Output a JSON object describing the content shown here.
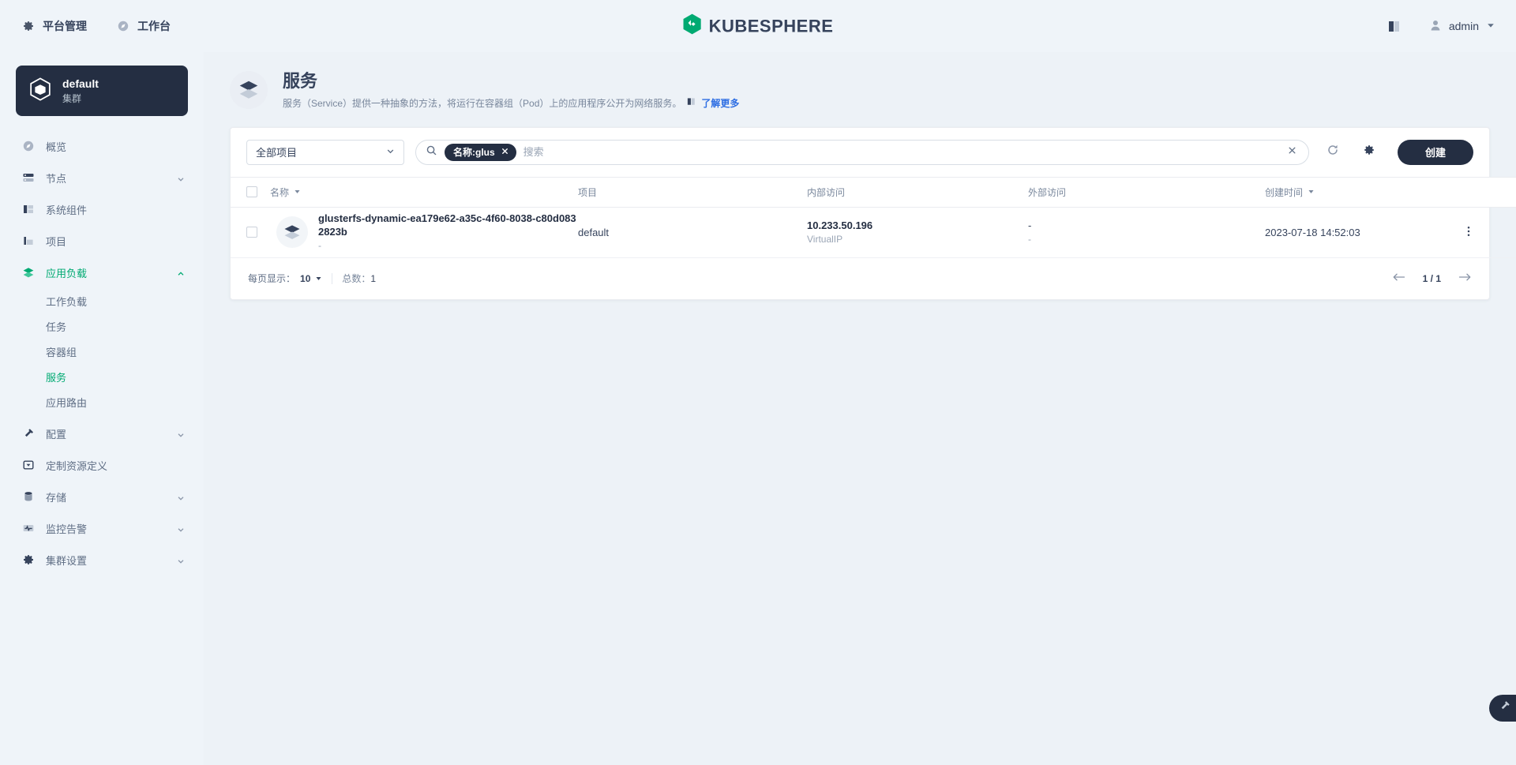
{
  "topbar": {
    "nav": [
      {
        "label": "平台管理",
        "icon": "gear-icon"
      },
      {
        "label": "工作台",
        "icon": "compass-icon"
      }
    ],
    "brand": "KUBESPHERE",
    "doc_icon": "book-icon",
    "user": {
      "name": "admin",
      "avatar_icon": "user-icon",
      "caret_icon": "chevron-down-icon"
    }
  },
  "sidebar": {
    "cluster": {
      "name": "default",
      "subtitle": "集群",
      "icon": "cube-icon"
    },
    "items": [
      {
        "label": "概览",
        "icon": "compass-icon",
        "caret": false,
        "active": false
      },
      {
        "label": "节点",
        "icon": "nodes-icon",
        "caret": true,
        "active": false
      },
      {
        "label": "系统组件",
        "icon": "components-icon",
        "caret": false,
        "active": false
      },
      {
        "label": "项目",
        "icon": "project-icon",
        "caret": false,
        "active": false
      },
      {
        "label": "应用负载",
        "icon": "workload-icon",
        "caret": true,
        "active": true
      },
      {
        "label": "配置",
        "icon": "hammer-icon",
        "caret": true,
        "active": false
      },
      {
        "label": "定制资源定义",
        "icon": "crd-icon",
        "caret": false,
        "active": false
      },
      {
        "label": "存储",
        "icon": "storage-icon",
        "caret": true,
        "active": false
      },
      {
        "label": "监控告警",
        "icon": "monitor-icon",
        "caret": true,
        "active": false
      },
      {
        "label": "集群设置",
        "icon": "gear-icon",
        "caret": true,
        "active": false
      }
    ],
    "submenu": [
      {
        "label": "工作负载",
        "active": false
      },
      {
        "label": "任务",
        "active": false
      },
      {
        "label": "容器组",
        "active": false
      },
      {
        "label": "服务",
        "active": true
      },
      {
        "label": "应用路由",
        "active": false
      }
    ]
  },
  "page": {
    "title": "服务",
    "icon": "service-icon",
    "description": "服务（Service）提供一种抽象的方法，将运行在容器组（Pod）上的应用程序公开为网络服务。",
    "learn_more": "了解更多",
    "learn_more_icon": "book-icon"
  },
  "toolbar": {
    "project_filter": {
      "value": "全部项目",
      "caret_icon": "chevron-down-icon"
    },
    "search": {
      "icon": "search-icon",
      "placeholder": "搜索",
      "value": "",
      "chip": {
        "label": "名称:glus",
        "remove_icon": "close-icon"
      },
      "clear_icon": "close-icon"
    },
    "refresh_icon": "refresh-icon",
    "settings_icon": "gear-icon",
    "create_label": "创建"
  },
  "table": {
    "select_all_checkbox": false,
    "columns": [
      {
        "key": "name",
        "label": "名称",
        "sort": "desc"
      },
      {
        "key": "project",
        "label": "项目",
        "sort": null
      },
      {
        "key": "internal",
        "label": "内部访问",
        "sort": null
      },
      {
        "key": "external",
        "label": "外部访问",
        "sort": null
      },
      {
        "key": "created",
        "label": "创建时间",
        "sort": "desc"
      }
    ],
    "rows": [
      {
        "icon": "service-icon",
        "name": "glusterfs-dynamic-ea179e62-a35c-4f60-8038-c80d0832823b",
        "name_sub": "-",
        "project": "default",
        "internal_ip": "10.233.50.196",
        "internal_type": "VirtualIP",
        "external_main": "-",
        "external_sub": "-",
        "created": "2023-07-18 14:52:03",
        "actions_icon": "more-vertical-icon"
      }
    ]
  },
  "pagination": {
    "per_page_label": "每页显示：",
    "per_page_value": "10",
    "per_page_caret": "chevron-down-icon",
    "total_label": "总数：",
    "total_value": "1",
    "prev_icon": "arrow-left-icon",
    "next_icon": "arrow-right-icon",
    "page_indicator": "1 / 1"
  },
  "fab": {
    "icon": "hammer-icon"
  },
  "colors": {
    "accent_green": "#00aa72",
    "dark_navy": "#242e42",
    "link_blue": "#2f6fe3",
    "page_bg": "#edf2f7"
  }
}
